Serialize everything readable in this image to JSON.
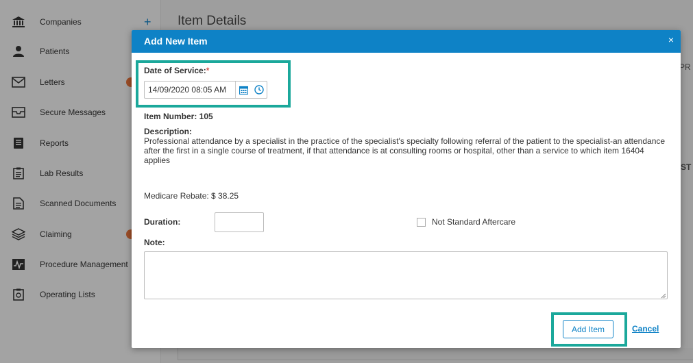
{
  "sidebar": {
    "items": [
      {
        "label": "Companies",
        "icon": "bank-icon"
      },
      {
        "label": "Patients",
        "icon": "person-icon"
      },
      {
        "label": "Letters",
        "icon": "envelope-icon"
      },
      {
        "label": "Secure Messages",
        "icon": "inbox-icon"
      },
      {
        "label": "Reports",
        "icon": "report-icon"
      },
      {
        "label": "Lab Results",
        "icon": "clipboard-icon"
      },
      {
        "label": "Scanned Documents",
        "icon": "document-icon"
      },
      {
        "label": "Claiming",
        "icon": "layers-icon"
      },
      {
        "label": "Procedure Management",
        "icon": "chart-icon"
      },
      {
        "label": "Operating Lists",
        "icon": "list-icon"
      }
    ],
    "plus": "+"
  },
  "main": {
    "title": "Item Details",
    "frag_pr": "PR",
    "frag_st": "ST"
  },
  "modal": {
    "title": "Add New Item",
    "close": "×",
    "date_label": "Date of Service:",
    "required_mark": "*",
    "date_value": "14/09/2020 08:05 AM",
    "item_number": "Item Number: 105",
    "description_label": "Description:",
    "description": "Professional attendance by a specialist in the practice of the specialist's specialty following referral of the patient to the specialist-an attendance after the first in a single course of treatment, if that attendance is at consulting rooms or hospital, other than a service to which item 16404 applies",
    "medicare_rebate": "Medicare Rebate: $ 38.25",
    "duration_label": "Duration:",
    "duration_value": "",
    "not_standard_label": "Not Standard Aftercare",
    "note_label": "Note:",
    "note_value": "",
    "add_button": "Add Item",
    "cancel": "Cancel"
  },
  "colors": {
    "header": "#0e82c6",
    "highlight": "#1ba89b",
    "badge": "#e8743b"
  }
}
